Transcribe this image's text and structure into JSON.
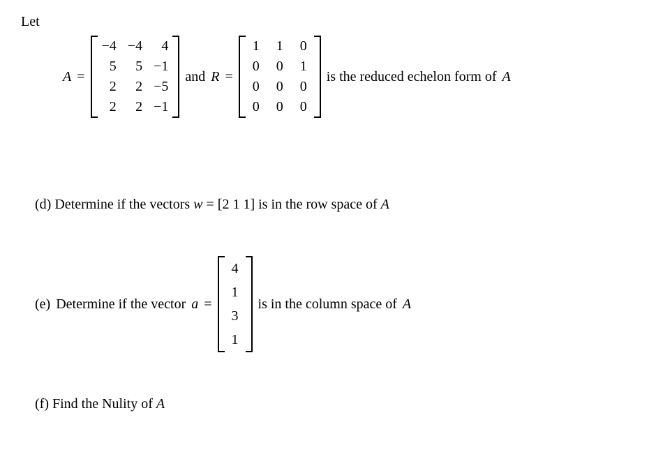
{
  "intro": "Let",
  "A_label": "A",
  "equals": "=",
  "A": [
    [
      "−4",
      "−4",
      "4"
    ],
    [
      "5",
      "5",
      "−1"
    ],
    [
      "2",
      "2",
      "−5"
    ],
    [
      "2",
      "2",
      "−1"
    ]
  ],
  "and_label": "and",
  "R_label": "R",
  "R": [
    [
      "1",
      "1",
      "0"
    ],
    [
      "0",
      "0",
      "1"
    ],
    [
      "0",
      "0",
      "0"
    ],
    [
      "0",
      "0",
      "0"
    ]
  ],
  "R_after": "is the reduced echelon form of",
  "R_after2": "A",
  "partD": {
    "label": "(d)",
    "text1": "Determine if the vectors",
    "var": "w",
    "eq": "=",
    "vec_open": "[",
    "vec": "2 1 1",
    "vec_close": "]",
    "text2": "is in the row space of",
    "A": "A"
  },
  "partE": {
    "label": "(e)",
    "text1": "Determine if the vector",
    "var": "a",
    "eq": "=",
    "vec": [
      "4",
      "1",
      "3",
      "1"
    ],
    "text2": "is in the column space of",
    "A": "A"
  },
  "partF": {
    "label": "(f)",
    "text": "Find the Nulity of ",
    "A": "A"
  }
}
